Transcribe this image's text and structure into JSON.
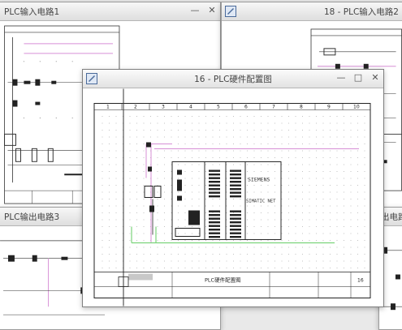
{
  "windows": {
    "input1": {
      "title": "PLC输入电路1"
    },
    "input2": {
      "title": "18 - PLC输入电路2"
    },
    "output3": {
      "title": "PLC输出电路3"
    },
    "output_right": {
      "title": "出电路"
    },
    "hardware": {
      "title": "16 - PLC硬件配置图",
      "ruler": [
        "1",
        "2",
        "3",
        "4",
        "5",
        "6",
        "7",
        "8",
        "9",
        "10"
      ],
      "module_labels": {
        "brand": "SIEMENS",
        "product": "SIMATIC NET"
      },
      "title_block": {
        "drawing_name": "PLC硬件配置图",
        "page_number": "16"
      }
    }
  },
  "controls": {
    "minimize": "—",
    "maximize": "□",
    "close": "✕"
  },
  "colors": {
    "wire_green": "#7bd37b",
    "wire_pink": "#d78fd6",
    "titlebar": "#e4e4e4"
  }
}
